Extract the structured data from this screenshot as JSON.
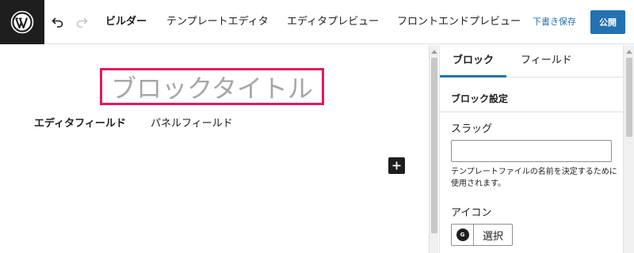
{
  "colors": {
    "accent": "#2271b1",
    "highlight_border": "#e5185d",
    "dark": "#1e1e1e",
    "placeholder_text": "#a7a7a7"
  },
  "toolbar": {
    "logo_icon": "wordpress-logo-icon",
    "undo_icon": "undo-icon",
    "redo_icon": "redo-icon",
    "nav": [
      {
        "label": "ビルダー",
        "active": true
      },
      {
        "label": "テンプレートエディタ",
        "active": false
      },
      {
        "label": "エディタプレビュー",
        "active": false
      },
      {
        "label": "フロントエンドプレビュー",
        "active": false
      }
    ],
    "draft_label": "下書き保存",
    "publish_label": "公開"
  },
  "editor": {
    "block_title": "ブロックタイトル",
    "tabs": [
      {
        "label": "エディタフィールド",
        "active": true
      },
      {
        "label": "パネルフィールド",
        "active": false
      }
    ],
    "add_block_icon": "plus-icon"
  },
  "sidebar": {
    "tabs": [
      {
        "label": "ブロック",
        "active": true
      },
      {
        "label": "フィールド",
        "active": false
      }
    ],
    "section_title": "ブロック設定",
    "slug_label": "スラッグ",
    "slug_value": "",
    "slug_help": "テンプレートファイルの名前を決定するために使用されます。",
    "icon_label": "アイコン",
    "icon_preview_text": "G",
    "icon_select_label": "選択"
  }
}
